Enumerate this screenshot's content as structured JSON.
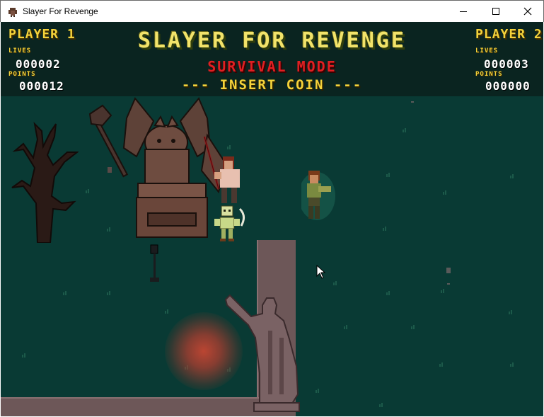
{
  "window": {
    "title": "Slayer For Revenge"
  },
  "hud": {
    "player1": {
      "label": "PLAYER 1",
      "lives_label": "LIVES",
      "lives": "000002",
      "points_label": "POINTS",
      "points": "000012"
    },
    "player2": {
      "label": "PLAYER 2",
      "lives_label": "LIVES",
      "lives": "000003",
      "points_label": "POINTS",
      "points": "000000"
    },
    "title": "SLAYER FOR REVENGE",
    "mode": "SURVIVAL MODE",
    "insert_coin": "--- INSERT COIN ---"
  },
  "colors": {
    "grass": "#093a34",
    "hud_bg": "#0a2420",
    "gold": "#f5d23a",
    "red": "#e01f22",
    "stone": "#6d5758"
  },
  "icons": [
    "app-icon",
    "minimize-icon",
    "maximize-icon",
    "close-icon",
    "mouse-cursor-icon"
  ]
}
